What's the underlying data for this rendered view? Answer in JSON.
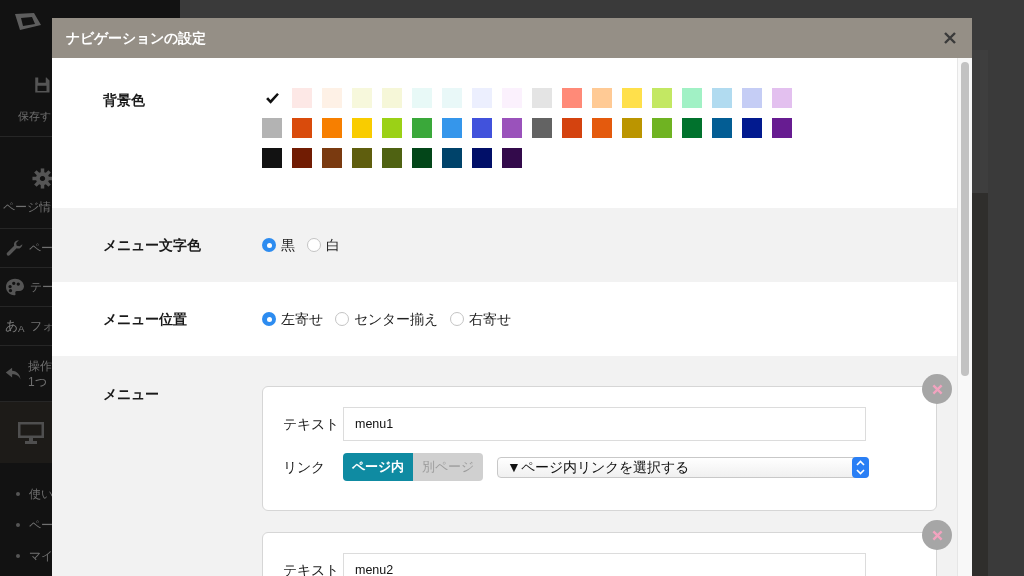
{
  "sidebar": {
    "tools": [
      {
        "kind": "save",
        "label": "保存す"
      },
      {
        "kind": "gear",
        "label": "ページ情"
      },
      {
        "kind": "wrench",
        "label": "ペー"
      },
      {
        "kind": "palette",
        "label": "テー"
      },
      {
        "kind": "font",
        "glyph": "あ$_{A}$",
        "label": "フォ"
      },
      {
        "kind": "undo",
        "lines": [
          "操作",
          "1つ"
        ]
      }
    ],
    "links": [
      "使い",
      "ペー",
      "マイ"
    ]
  },
  "dialog": {
    "title": "ナビゲーションの設定",
    "sections": [
      {
        "kind": "swatches",
        "label": "背景色",
        "swatches": [
          {
            "color": "#ffffff",
            "selected": true
          },
          {
            "color": "#fde8e6",
            "selected": false
          },
          {
            "color": "#fef1e6",
            "selected": false
          },
          {
            "color": "#f7f8dc",
            "selected": false
          },
          {
            "color": "#f6f7d8",
            "selected": false
          },
          {
            "color": "#e8f9f7",
            "selected": false
          },
          {
            "color": "#e9f8f8",
            "selected": false
          },
          {
            "color": "#eceffe",
            "selected": false
          },
          {
            "color": "#fbf1fd",
            "selected": false
          },
          {
            "color": "#e4e4e4",
            "selected": false
          },
          {
            "color": "#ff8a78",
            "selected": false
          },
          {
            "color": "#ffca95",
            "selected": false
          },
          {
            "color": "#ffe04b",
            "selected": false
          },
          {
            "color": "#c3e863",
            "selected": false
          },
          {
            "color": "#a1f1c5",
            "selected": false
          },
          {
            "color": "#b1dbf0",
            "selected": false
          },
          {
            "color": "#c5cdf5",
            "selected": false
          },
          {
            "color": "#e3c0ef",
            "selected": false
          },
          {
            "color": "#b3b3b3",
            "selected": false
          },
          {
            "color": "#d94b0c",
            "selected": false
          },
          {
            "color": "#f77f00",
            "selected": false
          },
          {
            "color": "#f9cc00",
            "selected": false
          },
          {
            "color": "#9bd116",
            "selected": false
          },
          {
            "color": "#3aa83a",
            "selected": false
          },
          {
            "color": "#3596eb",
            "selected": false
          },
          {
            "color": "#4152dc",
            "selected": false
          },
          {
            "color": "#9a52bb",
            "selected": false
          },
          {
            "color": "#636363",
            "selected": false
          },
          {
            "color": "#d4430f",
            "selected": false
          },
          {
            "color": "#e45a0d",
            "selected": false
          },
          {
            "color": "#bb9500",
            "selected": false
          },
          {
            "color": "#6fb322",
            "selected": false
          },
          {
            "color": "#01722d",
            "selected": false
          },
          {
            "color": "#035d94",
            "selected": false
          },
          {
            "color": "#021a8f",
            "selected": false
          },
          {
            "color": "#671c91",
            "selected": false
          },
          {
            "color": "#121212",
            "selected": false
          },
          {
            "color": "#711c03",
            "selected": false
          },
          {
            "color": "#7a3a10",
            "selected": false
          },
          {
            "color": "#5f5e0e",
            "selected": false
          },
          {
            "color": "#4f6212",
            "selected": false
          },
          {
            "color": "#034619",
            "selected": false
          },
          {
            "color": "#00436a",
            "selected": false
          },
          {
            "color": "#010f68",
            "selected": false
          },
          {
            "color": "#330a4b",
            "selected": false
          }
        ]
      },
      {
        "kind": "radios",
        "label": "メニュー文字色",
        "options": [
          {
            "label": "黒",
            "selected": true
          },
          {
            "label": "白",
            "selected": false
          }
        ]
      },
      {
        "kind": "radios",
        "label": "メニュー位置",
        "options": [
          {
            "label": "左寄せ",
            "selected": true
          },
          {
            "label": "センター揃え",
            "selected": false
          },
          {
            "label": "右寄せ",
            "selected": false
          }
        ]
      },
      {
        "kind": "menus",
        "label": "メニュー",
        "menus": [
          {
            "text_label": "テキスト",
            "text": "menu1",
            "link_label": "リンク",
            "link_modes": [
              {
                "label": "ページ内",
                "selected": true
              },
              {
                "label": "別ページ",
                "selected": false
              }
            ],
            "link_select": "▼ページ内リンクを選択する"
          },
          {
            "text_label": "テキスト",
            "text": "menu2"
          }
        ]
      }
    ]
  }
}
